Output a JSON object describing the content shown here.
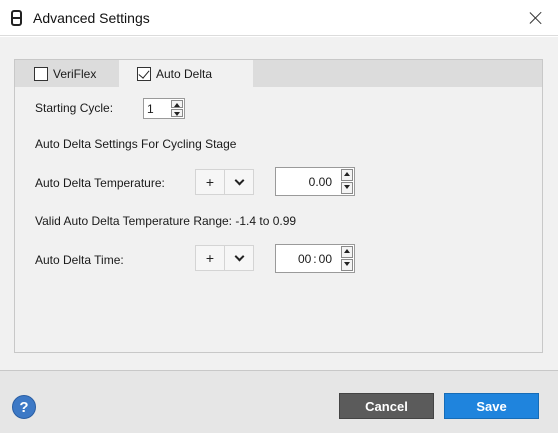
{
  "window": {
    "title": "Advanced Settings",
    "icon": "app-icon",
    "close_icon": "close-icon"
  },
  "tabs": [
    {
      "label": "VeriFlex",
      "checked": false
    },
    {
      "label": "Auto Delta",
      "checked": true
    }
  ],
  "starting_cycle": {
    "label": "Starting Cycle:",
    "value": "1"
  },
  "section_heading": "Auto Delta Settings For Cycling Stage",
  "temperature": {
    "label": "Auto Delta Temperature:",
    "sign_symbol": "+",
    "value": "0.00"
  },
  "valid_range_text": "Valid Auto Delta Temperature Range: -1.4 to 0.99",
  "time": {
    "label": "Auto Delta Time:",
    "sign_symbol": "+",
    "minutes": "00",
    "separator": ":",
    "seconds": "00"
  },
  "footer": {
    "help_symbol": "?",
    "cancel_label": "Cancel",
    "save_label": "Save"
  },
  "colors": {
    "save_button": "#1f84dd",
    "cancel_button": "#5b5b5b",
    "help_icon": "#3d79c6"
  }
}
